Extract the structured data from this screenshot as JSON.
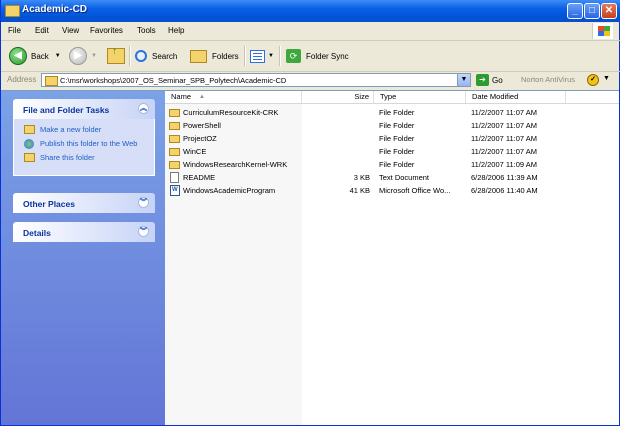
{
  "window": {
    "title": "Academic-CD",
    "min_glyph": "_",
    "max_glyph": "□",
    "close_glyph": "✕"
  },
  "menu": [
    "File",
    "Edit",
    "View",
    "Favorites",
    "Tools",
    "Help"
  ],
  "toolbar": {
    "back_label": "Back",
    "search_label": "Search",
    "folders_label": "Folders",
    "folder_sync_label": "Folder Sync"
  },
  "address": {
    "label": "Address",
    "path": "C:\\msr\\workshops\\2007_OS_Seminar_SPB_Polytech\\Academic-CD",
    "go_label": "Go",
    "norton_label": "Norton AntiVirus"
  },
  "task_pane": {
    "file_folder_tasks": {
      "title": "File and Folder Tasks",
      "items": [
        "Make a new folder",
        "Publish this folder to the Web",
        "Share this folder"
      ]
    },
    "other_places": {
      "title": "Other Places"
    },
    "details": {
      "title": "Details"
    }
  },
  "columns": {
    "name": "Name",
    "size": "Size",
    "type": "Type",
    "date": "Date Modified"
  },
  "files": [
    {
      "name": "CurriculumResourceKit-CRK",
      "size": "",
      "type": "File Folder",
      "date": "11/2/2007 11:07 AM",
      "icon": "folder-icon"
    },
    {
      "name": "PowerShell",
      "size": "",
      "type": "File Folder",
      "date": "11/2/2007 11:07 AM",
      "icon": "folder-icon"
    },
    {
      "name": "ProjectOZ",
      "size": "",
      "type": "File Folder",
      "date": "11/2/2007 11:07 AM",
      "icon": "folder-icon"
    },
    {
      "name": "WinCE",
      "size": "",
      "type": "File Folder",
      "date": "11/2/2007 11:07 AM",
      "icon": "folder-icon"
    },
    {
      "name": "WindowsResearchKernel-WRK",
      "size": "",
      "type": "File Folder",
      "date": "11/2/2007 11:09 AM",
      "icon": "folder-icon"
    },
    {
      "name": "README",
      "size": "3 KB",
      "type": "Text Document",
      "date": "6/28/2006 11:39 AM",
      "icon": "text-document-icon"
    },
    {
      "name": "WindowsAcademicProgram",
      "size": "41 KB",
      "type": "Microsoft Office Wo...",
      "date": "6/28/2006 11:40 AM",
      "icon": "word-document-icon"
    }
  ],
  "colors": {
    "titlebar": "#0a5fe6",
    "taskpane": "#7ba2e7",
    "link": "#215dc6"
  }
}
